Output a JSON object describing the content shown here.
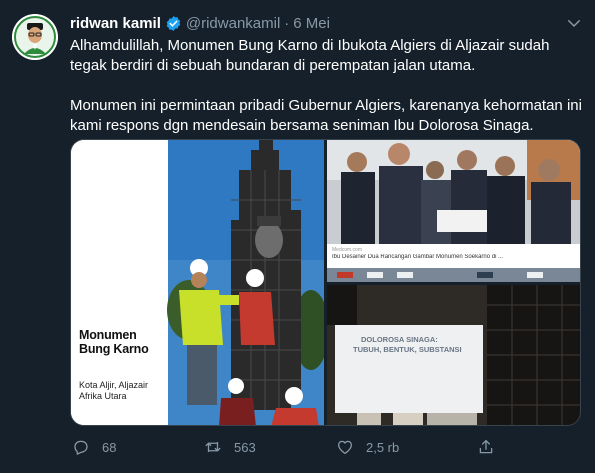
{
  "tweet": {
    "display_name": "ridwan kamil",
    "handle": "@ridwankamil",
    "separator": "·",
    "date": "6 Mei",
    "paragraphs": [
      "Alhamdulillah, Monumen Bung Karno di Ibukota Algiers di Aljazair sudah tegak berdiri di sebuah bundaran di perempatan jalan utama.",
      "Monumen ini permintaan pribadi Gubernur Algiers, karenanya kehormatan ini kami respons dgn mendesain bersama seniman Ibu Dolorosa Sinaga."
    ]
  },
  "media": {
    "left_panel": {
      "title_line1": "Monumen",
      "title_line2": "Bung Karno",
      "sub_line1": "Kota Aljir, Aljazair",
      "sub_line2": "Afrika Utara"
    },
    "top_right_panel": {
      "site": "Medcom.com",
      "caption": "Ibu Desainer Dua Rancangan Gambar Monumen Soekarno di ..."
    },
    "bottom_right_panel": {
      "banner_line1": "DOLOROSA SINAGA:",
      "banner_line2": "TUBUH, BENTUK, SUBSTANSI"
    }
  },
  "actions": {
    "reply_count": "68",
    "retweet_count": "563",
    "like_count": "2,5 rb"
  },
  "colors": {
    "background": "#15202b",
    "secondary_text": "#8899a6",
    "verified": "#1da1f2"
  }
}
